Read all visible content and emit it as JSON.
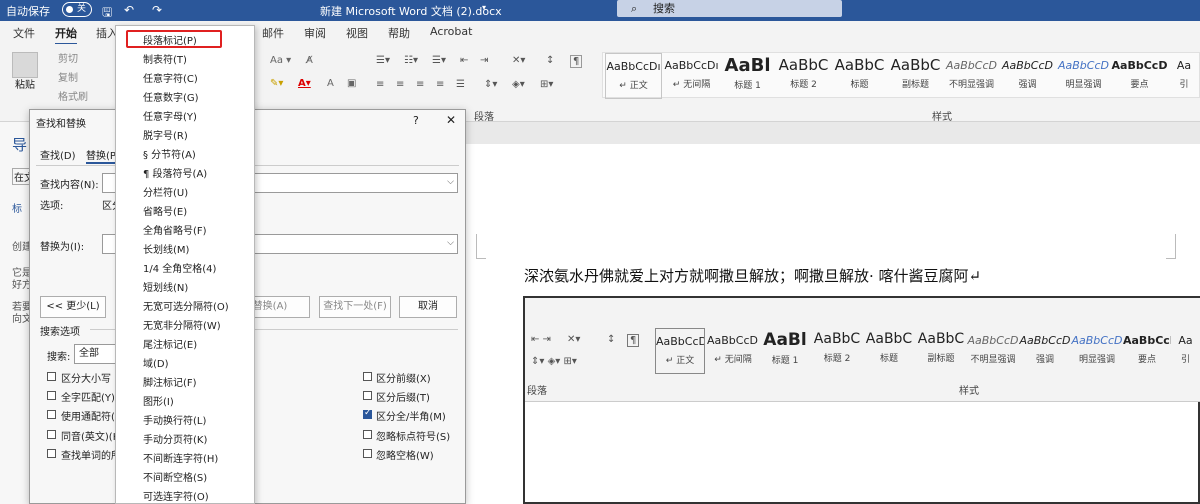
{
  "titlebar": {
    "autosave": "自动保存",
    "toggle": "关",
    "doc_title": "新建 Microsoft Word 文档 (2).docx",
    "search": "搜索"
  },
  "tabs": [
    "文件",
    "开始",
    "插入",
    "邮件",
    "审阅",
    "视图",
    "帮助",
    "Acrobat"
  ],
  "clipboard": {
    "paste": "粘贴",
    "cut": "剪切",
    "copy": "复制",
    "format": "格式刷"
  },
  "groups": {
    "paragraph": "段落",
    "styles": "样式"
  },
  "styles": [
    {
      "preview": "AaBbCcDı",
      "label": "正文"
    },
    {
      "preview": "AaBbCcDı",
      "label": "无间隔"
    },
    {
      "preview": "AaBl",
      "label": "标题 1"
    },
    {
      "preview": "AaBbC",
      "label": "标题 2"
    },
    {
      "preview": "AaBbC",
      "label": "标题"
    },
    {
      "preview": "AaBbC",
      "label": "副标题"
    },
    {
      "preview": "AaBbCcD",
      "label": "不明显强调"
    },
    {
      "preview": "AaBbCcD",
      "label": "强调"
    },
    {
      "preview": "AaBbCcD",
      "label": "明显强调"
    },
    {
      "preview": "AaBbCcD",
      "label": "要点"
    },
    {
      "preview": "Aa",
      "label": "引"
    }
  ],
  "document": {
    "text": "深浓氨水丹佛就爱上对方就啊撒旦解放；啊撒旦解放· 喀什酱豆腐阿↵"
  },
  "dialog": {
    "title": "查找和替换",
    "help": "?",
    "close": "✕",
    "tab_find": "查找(D)",
    "tab_replace": "替换(P)",
    "find_label": "查找内容(N):",
    "options_label": "选项:",
    "options_value": "区分",
    "replace_label": "替换为(I):",
    "more_button": "<< 更少(L)",
    "replace_button": "替换(A)",
    "find_next_button": "查找下一处(F)",
    "cancel_button": "取消",
    "search_options": "搜索选项",
    "search_label": "搜索:",
    "search_value": "全部",
    "left_checks": [
      "区分大小写",
      "全字匹配(Y)",
      "使用通配符(U)",
      "同音(英文)(K)",
      "查找单词的所"
    ],
    "right_checks": [
      "区分前缀(X)",
      "区分后缀(T)",
      "区分全/半角(M)",
      "忽略标点符号(S)",
      "忽略空格(W)"
    ]
  },
  "nav_pane": {
    "head": "导",
    "items": [
      "在文",
      "标",
      "创建",
      "它是",
      "好方",
      "若要",
      "向文"
    ]
  },
  "menu": [
    "段落标记(P)",
    "制表符(T)",
    "任意字符(C)",
    "任意数字(G)",
    "任意字母(Y)",
    "脱字号(R)",
    "§ 分节符(A)",
    "¶ 段落符号(A)",
    "分栏符(U)",
    "省略号(E)",
    "全角省略号(F)",
    "长划线(M)",
    "1/4 全角空格(4)",
    "短划线(N)",
    "无宽可选分隔符(O)",
    "无宽非分隔符(W)",
    "尾注标记(E)",
    "域(D)",
    "脚注标记(F)",
    "图形(I)",
    "手动换行符(L)",
    "手动分页符(K)",
    "不间断连字符(H)",
    "不间断空格(S)",
    "可选连字符(O)"
  ]
}
